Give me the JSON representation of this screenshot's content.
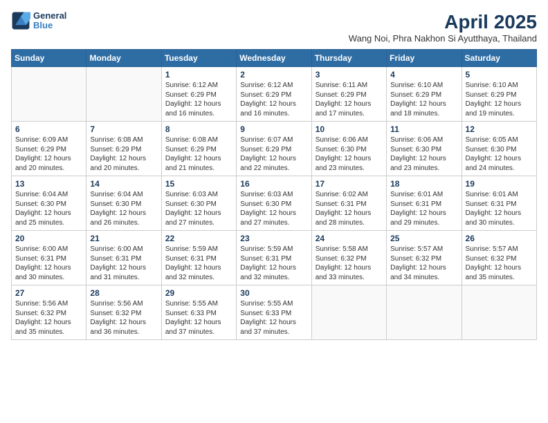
{
  "logo": {
    "line1": "General",
    "line2": "Blue"
  },
  "title": "April 2025",
  "subtitle": "Wang Noi, Phra Nakhon Si Ayutthaya, Thailand",
  "headers": [
    "Sunday",
    "Monday",
    "Tuesday",
    "Wednesday",
    "Thursday",
    "Friday",
    "Saturday"
  ],
  "weeks": [
    [
      {
        "day": "",
        "info": ""
      },
      {
        "day": "",
        "info": ""
      },
      {
        "day": "1",
        "info": "Sunrise: 6:12 AM\nSunset: 6:29 PM\nDaylight: 12 hours and 16 minutes."
      },
      {
        "day": "2",
        "info": "Sunrise: 6:12 AM\nSunset: 6:29 PM\nDaylight: 12 hours and 16 minutes."
      },
      {
        "day": "3",
        "info": "Sunrise: 6:11 AM\nSunset: 6:29 PM\nDaylight: 12 hours and 17 minutes."
      },
      {
        "day": "4",
        "info": "Sunrise: 6:10 AM\nSunset: 6:29 PM\nDaylight: 12 hours and 18 minutes."
      },
      {
        "day": "5",
        "info": "Sunrise: 6:10 AM\nSunset: 6:29 PM\nDaylight: 12 hours and 19 minutes."
      }
    ],
    [
      {
        "day": "6",
        "info": "Sunrise: 6:09 AM\nSunset: 6:29 PM\nDaylight: 12 hours and 20 minutes."
      },
      {
        "day": "7",
        "info": "Sunrise: 6:08 AM\nSunset: 6:29 PM\nDaylight: 12 hours and 20 minutes."
      },
      {
        "day": "8",
        "info": "Sunrise: 6:08 AM\nSunset: 6:29 PM\nDaylight: 12 hours and 21 minutes."
      },
      {
        "day": "9",
        "info": "Sunrise: 6:07 AM\nSunset: 6:29 PM\nDaylight: 12 hours and 22 minutes."
      },
      {
        "day": "10",
        "info": "Sunrise: 6:06 AM\nSunset: 6:30 PM\nDaylight: 12 hours and 23 minutes."
      },
      {
        "day": "11",
        "info": "Sunrise: 6:06 AM\nSunset: 6:30 PM\nDaylight: 12 hours and 23 minutes."
      },
      {
        "day": "12",
        "info": "Sunrise: 6:05 AM\nSunset: 6:30 PM\nDaylight: 12 hours and 24 minutes."
      }
    ],
    [
      {
        "day": "13",
        "info": "Sunrise: 6:04 AM\nSunset: 6:30 PM\nDaylight: 12 hours and 25 minutes."
      },
      {
        "day": "14",
        "info": "Sunrise: 6:04 AM\nSunset: 6:30 PM\nDaylight: 12 hours and 26 minutes."
      },
      {
        "day": "15",
        "info": "Sunrise: 6:03 AM\nSunset: 6:30 PM\nDaylight: 12 hours and 27 minutes."
      },
      {
        "day": "16",
        "info": "Sunrise: 6:03 AM\nSunset: 6:30 PM\nDaylight: 12 hours and 27 minutes."
      },
      {
        "day": "17",
        "info": "Sunrise: 6:02 AM\nSunset: 6:31 PM\nDaylight: 12 hours and 28 minutes."
      },
      {
        "day": "18",
        "info": "Sunrise: 6:01 AM\nSunset: 6:31 PM\nDaylight: 12 hours and 29 minutes."
      },
      {
        "day": "19",
        "info": "Sunrise: 6:01 AM\nSunset: 6:31 PM\nDaylight: 12 hours and 30 minutes."
      }
    ],
    [
      {
        "day": "20",
        "info": "Sunrise: 6:00 AM\nSunset: 6:31 PM\nDaylight: 12 hours and 30 minutes."
      },
      {
        "day": "21",
        "info": "Sunrise: 6:00 AM\nSunset: 6:31 PM\nDaylight: 12 hours and 31 minutes."
      },
      {
        "day": "22",
        "info": "Sunrise: 5:59 AM\nSunset: 6:31 PM\nDaylight: 12 hours and 32 minutes."
      },
      {
        "day": "23",
        "info": "Sunrise: 5:59 AM\nSunset: 6:31 PM\nDaylight: 12 hours and 32 minutes."
      },
      {
        "day": "24",
        "info": "Sunrise: 5:58 AM\nSunset: 6:32 PM\nDaylight: 12 hours and 33 minutes."
      },
      {
        "day": "25",
        "info": "Sunrise: 5:57 AM\nSunset: 6:32 PM\nDaylight: 12 hours and 34 minutes."
      },
      {
        "day": "26",
        "info": "Sunrise: 5:57 AM\nSunset: 6:32 PM\nDaylight: 12 hours and 35 minutes."
      }
    ],
    [
      {
        "day": "27",
        "info": "Sunrise: 5:56 AM\nSunset: 6:32 PM\nDaylight: 12 hours and 35 minutes."
      },
      {
        "day": "28",
        "info": "Sunrise: 5:56 AM\nSunset: 6:32 PM\nDaylight: 12 hours and 36 minutes."
      },
      {
        "day": "29",
        "info": "Sunrise: 5:55 AM\nSunset: 6:33 PM\nDaylight: 12 hours and 37 minutes."
      },
      {
        "day": "30",
        "info": "Sunrise: 5:55 AM\nSunset: 6:33 PM\nDaylight: 12 hours and 37 minutes."
      },
      {
        "day": "",
        "info": ""
      },
      {
        "day": "",
        "info": ""
      },
      {
        "day": "",
        "info": ""
      }
    ]
  ]
}
